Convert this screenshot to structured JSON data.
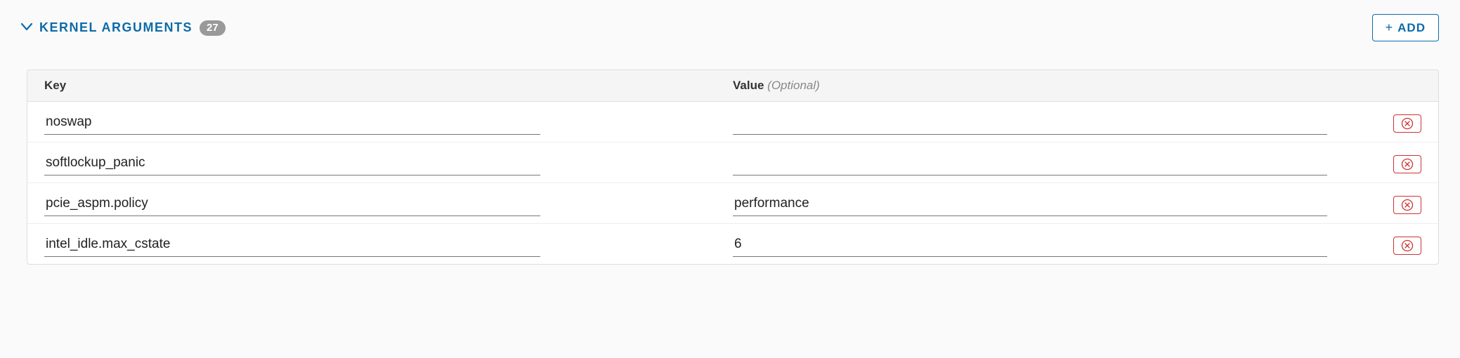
{
  "section": {
    "title": "KERNEL ARGUMENTS",
    "count": "27",
    "add_label": "ADD"
  },
  "headers": {
    "key": "Key",
    "value": "Value",
    "optional": "(Optional)"
  },
  "rows": [
    {
      "key": "noswap",
      "value": ""
    },
    {
      "key": "softlockup_panic",
      "value": ""
    },
    {
      "key": "pcie_aspm.policy",
      "value": "performance"
    },
    {
      "key": "intel_idle.max_cstate",
      "value": "6"
    }
  ]
}
